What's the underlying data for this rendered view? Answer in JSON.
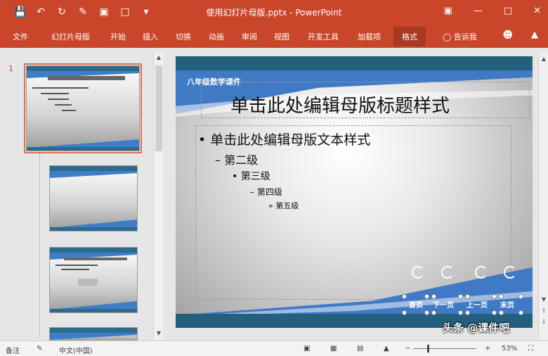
{
  "titlebar": {
    "title": "使用幻灯片母版.pptx - PowerPoint",
    "qat": [
      "save-icon",
      "undo-icon",
      "redo-icon",
      "format-painter-icon",
      "save-as-icon",
      "new-icon",
      "customize-icon"
    ],
    "window_buttons": [
      "ribbon-display-icon",
      "minimize-icon",
      "maximize-icon",
      "close-icon"
    ]
  },
  "tabs": [
    "文件",
    "幻灯片母版",
    "开始",
    "插入",
    "切换",
    "动画",
    "审阅",
    "视图",
    "开发工具",
    "加载项",
    "格式",
    "告诉我"
  ],
  "active_tab": "格式",
  "thumbpane": {
    "slide_number": "1"
  },
  "slide": {
    "subtitle": "八年级数学课件",
    "title": "单击此处编辑母版标题样式",
    "levels": [
      "单击此处编辑母版文本样式",
      "第二级",
      "第三级",
      "第四级",
      "第五级"
    ],
    "bullets": [
      "•",
      "–",
      "•",
      "–",
      "»"
    ],
    "nav_buttons": [
      "首页",
      "下一页",
      "上一页",
      "末页"
    ]
  },
  "statusbar": {
    "notes": "备注",
    "language": "中文(中国)",
    "zoom": "53%"
  },
  "watermark": "头条 @课件吧",
  "colors": {
    "accent": "#c9462a",
    "slide_blue": "#4079c4",
    "slide_dark": "#23607d"
  }
}
